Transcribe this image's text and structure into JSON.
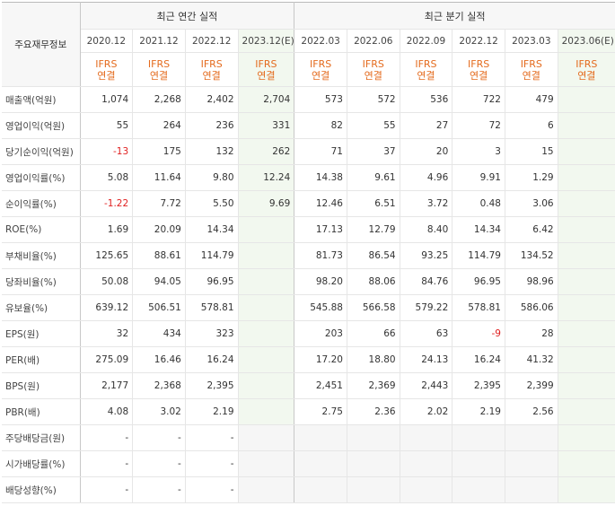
{
  "header": {
    "corner_label": "주요재무정보",
    "annual_group": "최근 연간 실적",
    "quarter_group": "최근 분기 실적"
  },
  "columns": [
    {
      "period": "2020.12",
      "basis": "IFRS",
      "consol": "연결",
      "estimate": false
    },
    {
      "period": "2021.12",
      "basis": "IFRS",
      "consol": "연결",
      "estimate": false
    },
    {
      "period": "2022.12",
      "basis": "IFRS",
      "consol": "연결",
      "estimate": false
    },
    {
      "period": "2023.12(E)",
      "basis": "IFRS",
      "consol": "연결",
      "estimate": true
    },
    {
      "period": "2022.03",
      "basis": "IFRS",
      "consol": "연결",
      "estimate": false
    },
    {
      "period": "2022.06",
      "basis": "IFRS",
      "consol": "연결",
      "estimate": false
    },
    {
      "period": "2022.09",
      "basis": "IFRS",
      "consol": "연결",
      "estimate": false
    },
    {
      "period": "2022.12",
      "basis": "IFRS",
      "consol": "연결",
      "estimate": false
    },
    {
      "period": "2023.03",
      "basis": "IFRS",
      "consol": "연결",
      "estimate": false
    },
    {
      "period": "2023.06(E)",
      "basis": "IFRS",
      "consol": "연결",
      "estimate": true
    }
  ],
  "rows": [
    {
      "label": "매출액(억원)",
      "values": [
        "1,074",
        "2,268",
        "2,402",
        "2,704",
        "573",
        "572",
        "536",
        "722",
        "479",
        ""
      ]
    },
    {
      "label": "영업이익(억원)",
      "values": [
        "55",
        "264",
        "236",
        "331",
        "82",
        "55",
        "27",
        "72",
        "6",
        ""
      ]
    },
    {
      "label": "당기순이익(억원)",
      "values": [
        "-13",
        "175",
        "132",
        "262",
        "71",
        "37",
        "20",
        "3",
        "15",
        ""
      ]
    },
    {
      "label": "영업이익률(%)",
      "values": [
        "5.08",
        "11.64",
        "9.80",
        "12.24",
        "14.38",
        "9.61",
        "4.96",
        "9.91",
        "1.29",
        ""
      ]
    },
    {
      "label": "순이익률(%)",
      "values": [
        "-1.22",
        "7.72",
        "5.50",
        "9.69",
        "12.46",
        "6.51",
        "3.72",
        "0.48",
        "3.06",
        ""
      ]
    },
    {
      "label": "ROE(%)",
      "values": [
        "1.69",
        "20.09",
        "14.34",
        "",
        "17.13",
        "12.79",
        "8.40",
        "14.34",
        "6.42",
        ""
      ]
    },
    {
      "label": "부채비율(%)",
      "values": [
        "125.65",
        "88.61",
        "114.79",
        "",
        "81.73",
        "86.54",
        "93.25",
        "114.79",
        "134.52",
        ""
      ]
    },
    {
      "label": "당좌비율(%)",
      "values": [
        "50.08",
        "94.05",
        "96.95",
        "",
        "98.20",
        "88.06",
        "84.76",
        "96.95",
        "98.96",
        ""
      ]
    },
    {
      "label": "유보율(%)",
      "values": [
        "639.12",
        "506.51",
        "578.81",
        "",
        "545.88",
        "566.58",
        "579.22",
        "578.81",
        "586.06",
        ""
      ]
    },
    {
      "label": "EPS(원)",
      "values": [
        "32",
        "434",
        "323",
        "",
        "203",
        "66",
        "63",
        "-9",
        "28",
        ""
      ]
    },
    {
      "label": "PER(배)",
      "values": [
        "275.09",
        "16.46",
        "16.24",
        "",
        "17.20",
        "18.80",
        "24.13",
        "16.24",
        "41.32",
        ""
      ]
    },
    {
      "label": "BPS(원)",
      "values": [
        "2,177",
        "2,368",
        "2,395",
        "",
        "2,451",
        "2,369",
        "2,443",
        "2,395",
        "2,399",
        ""
      ]
    },
    {
      "label": "PBR(배)",
      "values": [
        "4.08",
        "3.02",
        "2.19",
        "",
        "2.75",
        "2.36",
        "2.02",
        "2.19",
        "2.56",
        ""
      ]
    },
    {
      "label": "주당배당금(원)",
      "values": [
        "-",
        "-",
        "-",
        "",
        "",
        "",
        "",
        "",
        "",
        ""
      ]
    },
    {
      "label": "시가배당률(%)",
      "values": [
        "-",
        "-",
        "-",
        "",
        "",
        "",
        "",
        "",
        "",
        ""
      ]
    },
    {
      "label": "배당성향(%)",
      "values": [
        "-",
        "-",
        "-",
        "",
        "",
        "",
        "",
        "",
        "",
        ""
      ]
    }
  ],
  "colors": {
    "negative": "#e02020",
    "ifrs_accent": "#e46b1e",
    "estimate_bg": "#f2f8ef"
  }
}
